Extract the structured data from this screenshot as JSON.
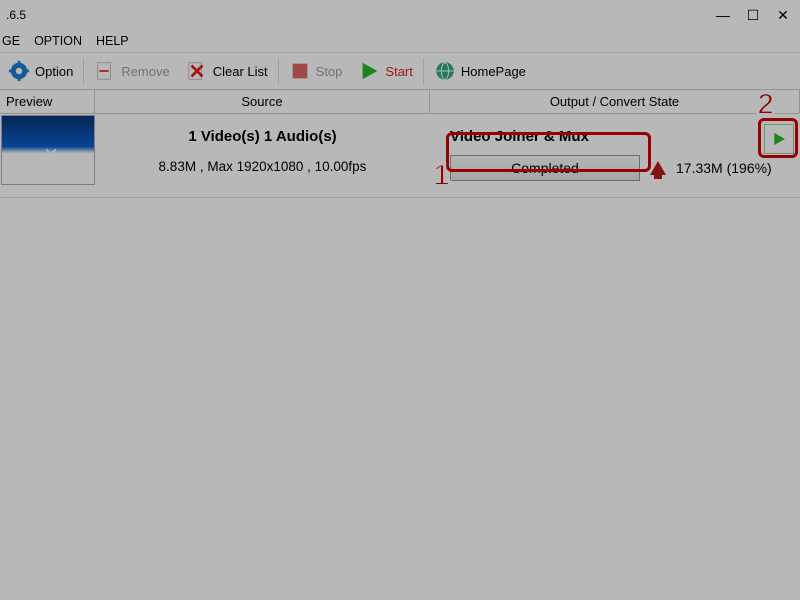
{
  "title": ".6.5",
  "window_controls": {
    "min": "—",
    "max": "☐",
    "close": "✕"
  },
  "menu": {
    "page": "GE",
    "option": "OPTION",
    "help": "HELP"
  },
  "toolbar": {
    "option_label": "Option",
    "remove_label": "Remove",
    "clearlist_label": "Clear List",
    "stop_label": "Stop",
    "start_label": "Start",
    "homepage_label": "HomePage"
  },
  "headers": {
    "preview": "Preview",
    "source": "Source",
    "output": "Output / Convert State"
  },
  "row": {
    "source_title": "1 Video(s) 1 Audio(s)",
    "source_sub": "8.83M , Max 1920x1080 , 10.00fps",
    "output_title": "Video Joiner & Mux",
    "completed_label": "Completed",
    "size_text": "17.33M  (196%)"
  },
  "annotations": {
    "one": "1",
    "two": "2"
  }
}
